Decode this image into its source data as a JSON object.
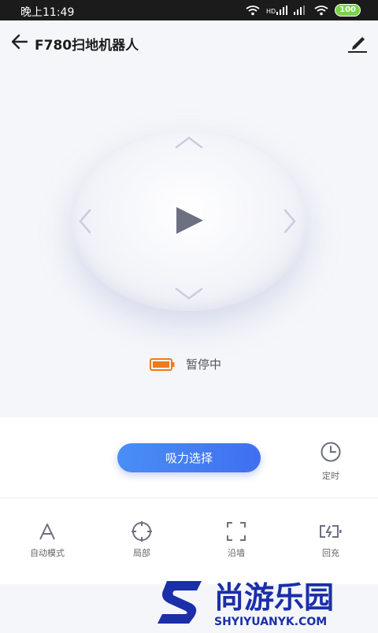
{
  "status_bar": {
    "time": "晚上11:49",
    "signal1": "HD",
    "battery": "100"
  },
  "header": {
    "title": "F780扫地机器人"
  },
  "control": {
    "status_text": "暂停中",
    "battery_color": "#f07a1a"
  },
  "actions": {
    "suction_label": "吸力选择",
    "timer_label": "定时"
  },
  "modes": [
    {
      "label": "自动模式",
      "icon": "letter-a-icon"
    },
    {
      "label": "局部",
      "icon": "crosshair-icon"
    },
    {
      "label": "沿墙",
      "icon": "frame-corners-icon"
    },
    {
      "label": "回充",
      "icon": "charging-battery-icon"
    }
  ],
  "watermark": {
    "logo_text": "尚游乐园",
    "url_text": "SHYIYUANYK.COM"
  },
  "colors": {
    "accent": "#4a80f4",
    "icon_gray": "#6c7080"
  }
}
